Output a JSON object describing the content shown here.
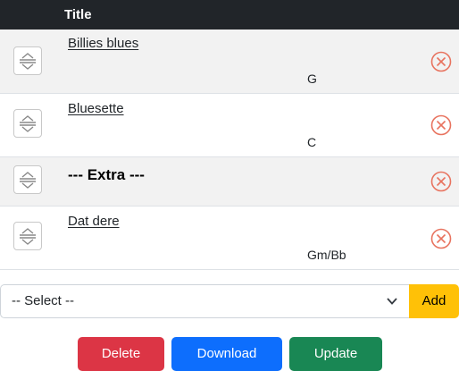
{
  "table": {
    "header_title": "Title",
    "rows": [
      {
        "title": "Billies blues",
        "key": "G"
      },
      {
        "title": "Bluesette",
        "key": "C"
      },
      {
        "title": "--- Extra ---",
        "key": ""
      },
      {
        "title": "Dat dere",
        "key": "Gm/Bb"
      }
    ]
  },
  "add_form": {
    "select_value": "-- Select --",
    "add_label": "Add"
  },
  "actions": {
    "delete_label": "Delete",
    "download_label": "Download",
    "update_label": "Update"
  },
  "colors": {
    "header_bg": "#212529",
    "stripe_bg": "#f2f2f2",
    "remove_icon": "#e8735f",
    "add_button": "#ffc107",
    "delete_button": "#dc3545",
    "download_button": "#0d6efd",
    "update_button": "#198754"
  },
  "icons": {
    "drag_handle": "drag-handle-icon",
    "remove": "remove-circle-x-icon",
    "select_chevron": "chevron-down-icon"
  }
}
